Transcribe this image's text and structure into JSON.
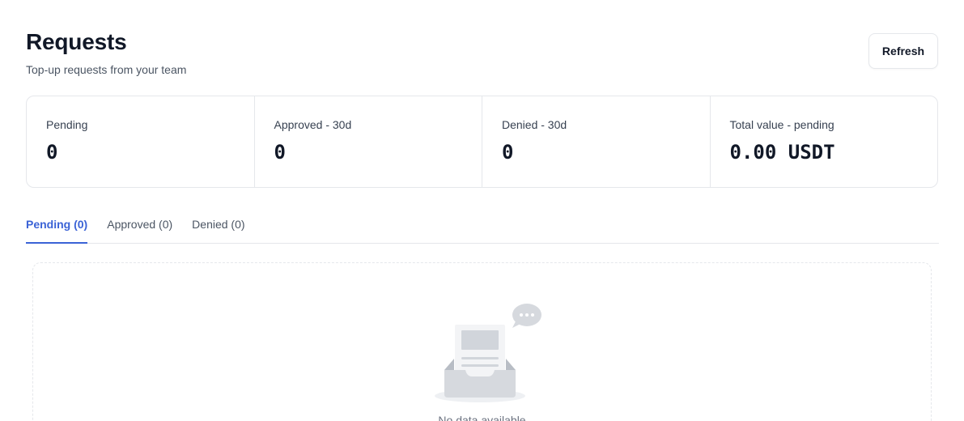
{
  "header": {
    "title": "Requests",
    "subtitle": "Top-up requests from your team",
    "refresh_label": "Refresh"
  },
  "stats": [
    {
      "label": "Pending",
      "value": "0"
    },
    {
      "label": "Approved - 30d",
      "value": "0"
    },
    {
      "label": "Denied - 30d",
      "value": "0"
    },
    {
      "label": "Total value - pending",
      "value": "0.00 USDT"
    }
  ],
  "tabs": [
    {
      "label": "Pending (0)",
      "active": true
    },
    {
      "label": "Approved (0)",
      "active": false
    },
    {
      "label": "Denied (0)",
      "active": false
    }
  ],
  "empty_state": {
    "message": "No data available",
    "icon": "empty-inbox-icon"
  },
  "colors": {
    "accent": "#3b63d6",
    "border": "#e5e7eb",
    "text_primary": "#111827",
    "text_secondary": "#4b5563"
  }
}
